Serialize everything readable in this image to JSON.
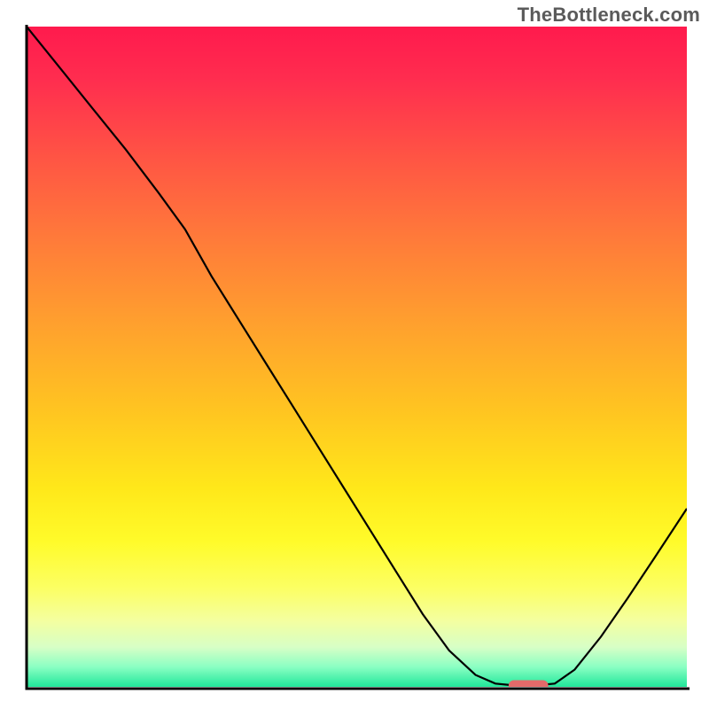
{
  "watermark": "TheBottleneck.com",
  "chart_data": {
    "type": "line",
    "title": "",
    "xlabel": "",
    "ylabel": "",
    "xlim": [
      0,
      100
    ],
    "ylim": [
      0,
      100
    ],
    "curve_points": [
      {
        "x": 0,
        "y": 100.0
      },
      {
        "x": 5,
        "y": 93.8
      },
      {
        "x": 10,
        "y": 87.6
      },
      {
        "x": 15,
        "y": 81.4
      },
      {
        "x": 20,
        "y": 74.8
      },
      {
        "x": 24,
        "y": 69.3
      },
      {
        "x": 28,
        "y": 62.2
      },
      {
        "x": 32,
        "y": 55.8
      },
      {
        "x": 36,
        "y": 49.4
      },
      {
        "x": 40,
        "y": 43.0
      },
      {
        "x": 44,
        "y": 36.6
      },
      {
        "x": 48,
        "y": 30.2
      },
      {
        "x": 52,
        "y": 23.8
      },
      {
        "x": 56,
        "y": 17.4
      },
      {
        "x": 60,
        "y": 11.0
      },
      {
        "x": 64,
        "y": 5.5
      },
      {
        "x": 68,
        "y": 1.8
      },
      {
        "x": 71,
        "y": 0.5
      },
      {
        "x": 74,
        "y": 0.2
      },
      {
        "x": 77,
        "y": 0.2
      },
      {
        "x": 80,
        "y": 0.5
      },
      {
        "x": 83,
        "y": 2.6
      },
      {
        "x": 87,
        "y": 7.6
      },
      {
        "x": 91,
        "y": 13.4
      },
      {
        "x": 95,
        "y": 19.4
      },
      {
        "x": 100,
        "y": 27.0
      }
    ],
    "marker_region": {
      "x_start": 73,
      "x_end": 79,
      "y": 0.2
    },
    "gradient_stops": [
      {
        "pct": 0,
        "color": "#ff1a4d"
      },
      {
        "pct": 50,
        "color": "#ffc421"
      },
      {
        "pct": 85,
        "color": "#fcff63"
      },
      {
        "pct": 100,
        "color": "#20e79a"
      }
    ]
  }
}
